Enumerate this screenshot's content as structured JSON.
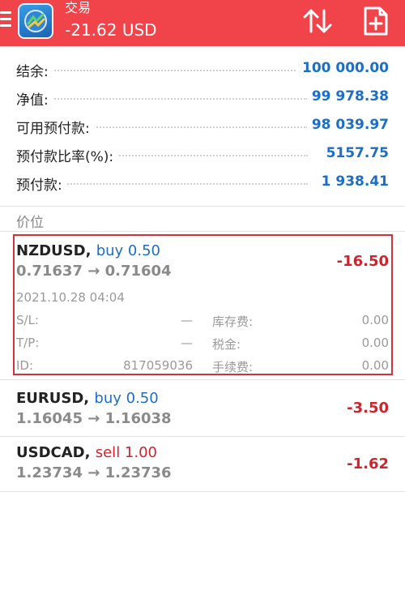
{
  "header": {
    "title": "交易",
    "subtitle": "-21.62 USD",
    "icons": [
      "menu-icon",
      "app-logo",
      "sort-icon",
      "new-document-icon"
    ],
    "bg_color": "#f0434a"
  },
  "summary": [
    {
      "label": "结余:",
      "value": "100 000.00"
    },
    {
      "label": "净值:",
      "value": "99 978.38"
    },
    {
      "label": "可用预付款:",
      "value": "98 039.97"
    },
    {
      "label": "预付款比率(%):",
      "value": "5157.75"
    },
    {
      "label": "预付款:",
      "value": "1 938.41"
    }
  ],
  "section_title": "价位",
  "positions": [
    {
      "symbol": "NZDUSD,",
      "side": "buy 0.50",
      "prices": "0.71637 → 0.71604",
      "profit": "-16.50",
      "expanded": true,
      "details": {
        "time": "2021.10.28 04:04",
        "sl_label": "S/L:",
        "sl_value": "—",
        "tp_label": "T/P:",
        "tp_value": "—",
        "id_label": "ID:",
        "id_value": "817059036",
        "swap_label": "库存费:",
        "swap_value": "0.00",
        "tax_label": "税金:",
        "tax_value": "0.00",
        "fee_label": "手续费:",
        "fee_value": "0.00"
      }
    },
    {
      "symbol": "EURUSD,",
      "side": "buy 0.50",
      "prices": "1.16045 → 1.16038",
      "profit": "-3.50"
    },
    {
      "symbol": "USDCAD,",
      "side": "sell 1.00",
      "prices": "1.23734 → 1.23736",
      "profit": "-1.62"
    }
  ],
  "colors": {
    "accent": "#1c6ec8",
    "loss": "#d2222c",
    "highlight": "#d1323e"
  }
}
